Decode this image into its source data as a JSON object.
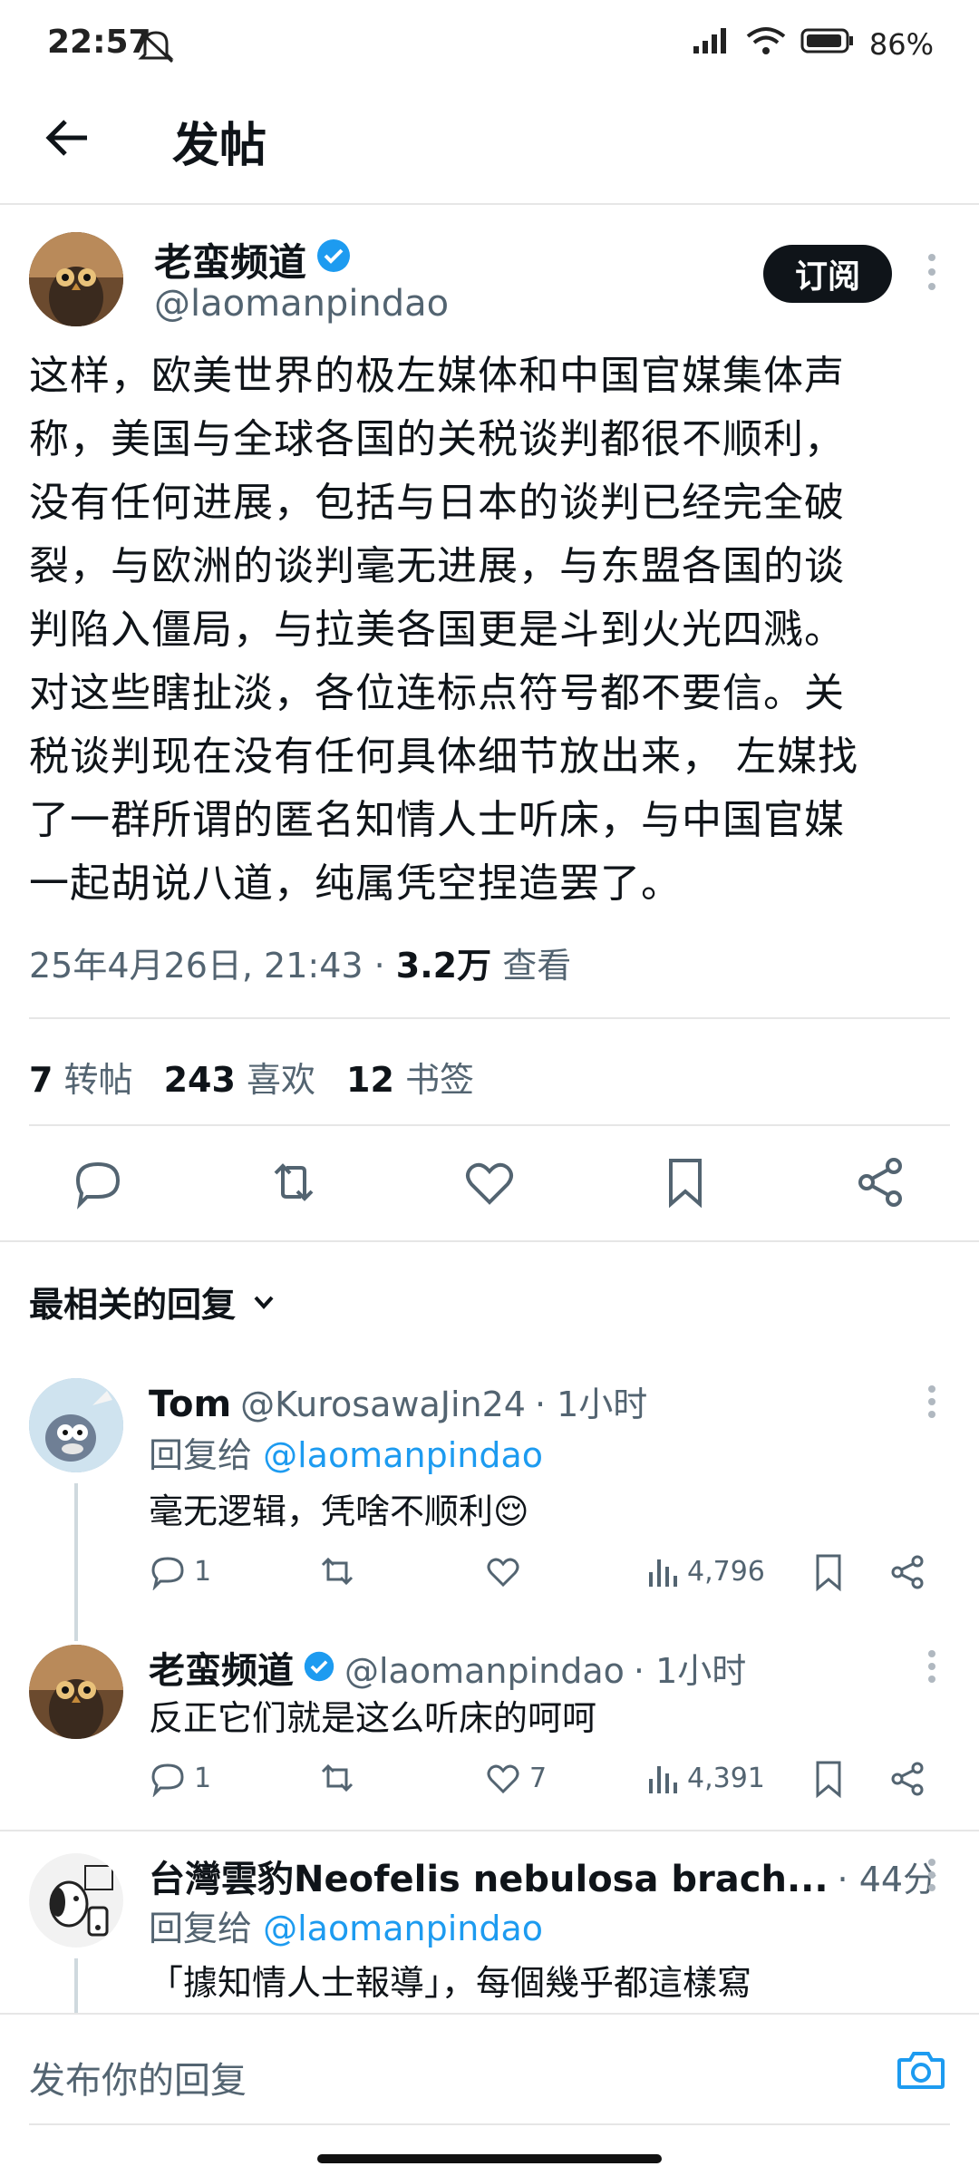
{
  "status": {
    "time": "22:57",
    "battery": "86%"
  },
  "header": {
    "title": "发帖"
  },
  "post": {
    "author_name": "老蛮频道",
    "author_handle": "@laomanpindao",
    "subscribe_label": "订阅",
    "lines": [
      "这样，欧美世界的极左媒体和中国官媒集体声",
      "称，美国与全球各国的关税谈判都很不顺利，",
      "没有任何进展，包括与日本的谈判已经完全破",
      "裂，与欧洲的谈判毫无进展，与东盟各国的谈",
      "判陷入僵局，与拉美各国更是斗到火光四溅。",
      "对这些瞎扯淡，各位连标点符号都不要信。关",
      "税谈判现在没有任何具体细节放出来， 左媒找",
      "了一群所谓的匿名知情人士听床，与中国官媒",
      "一起胡说八道，纯属凭空捏造罢了。"
    ],
    "timestamp": "25年4月26日, 21:43 · ",
    "views_count": "3.2万",
    "views_label": " 查看",
    "reposts_count": "7",
    "reposts_label": "转帖",
    "likes_count": "243",
    "likes_label": "喜欢",
    "bookmarks_count": "12",
    "bookmarks_label": "书签"
  },
  "replies_header": {
    "label": "最相关的回复"
  },
  "replies": [
    {
      "name": "Tom",
      "handle": "@KurosawaJin24",
      "time": " · 1小时",
      "reply_to_prefix": "回复给 ",
      "reply_to_handle": "@laomanpindao",
      "text": "毫无逻辑，凭啥不顺利😌",
      "comments": "1",
      "retweets": "",
      "likes": "",
      "views": "4,796"
    },
    {
      "name": "老蛮频道",
      "handle": "@laomanpindao",
      "time": " · 1小时",
      "text": "反正它们就是这么听床的呵呵",
      "comments": "1",
      "retweets": "",
      "likes": "7",
      "views": "4,391"
    },
    {
      "name": "台灣雲豹Neofelis nebulosa brach...",
      "handle": "",
      "time": " · 44分",
      "reply_to_prefix": "回复给 ",
      "reply_to_handle": "@laomanpindao",
      "text": "「據知情人士報導」，每個幾乎都這樣寫"
    }
  ],
  "composer": {
    "placeholder": "发布你的回复"
  },
  "colors": {
    "accent": "#1d9bf0",
    "text": "#0f1419",
    "muted": "#536471",
    "divider": "#e6e6e6"
  }
}
